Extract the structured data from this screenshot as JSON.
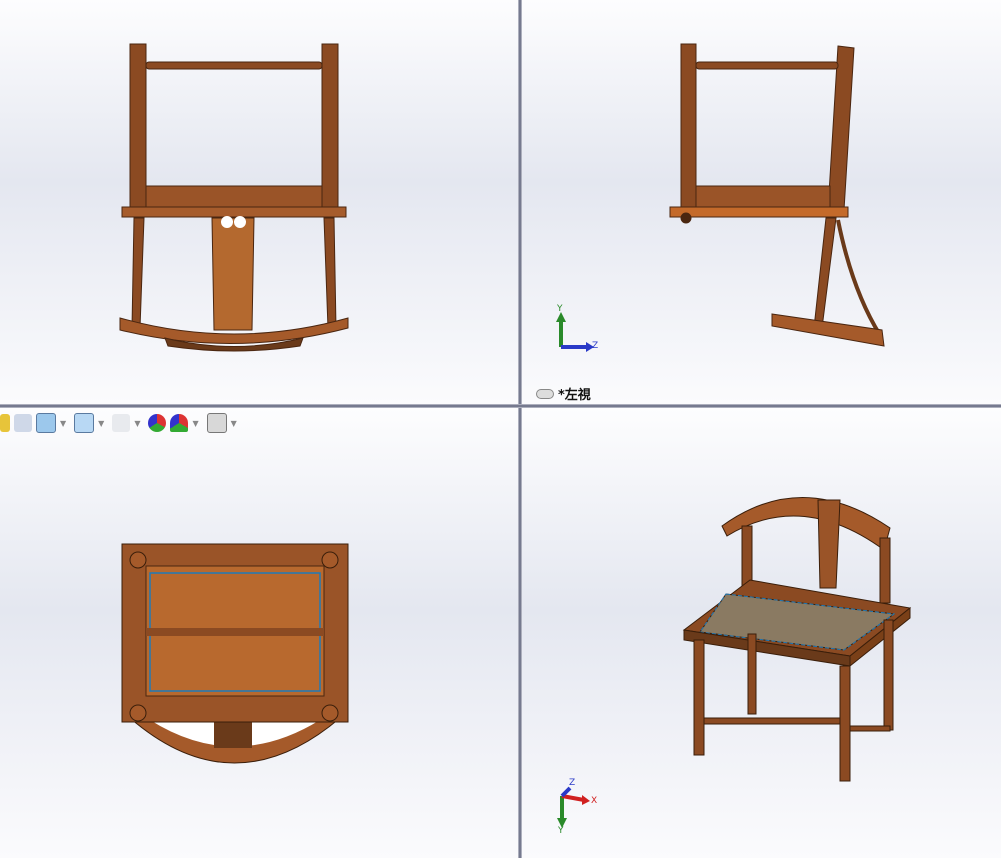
{
  "viewports": [
    {
      "name": "front-view"
    },
    {
      "name": "left-view",
      "label": "*左視"
    },
    {
      "name": "top-view"
    },
    {
      "name": "isometric-view"
    }
  ],
  "triad_left": {
    "x": "",
    "y": "Y",
    "z": "Z"
  },
  "triad_iso": {
    "x": "X",
    "y": "Y",
    "z": "Z"
  },
  "toolbar": {
    "icons": [
      "view-orientation-icon",
      "previous-view-icon",
      "section-view-icon",
      "display-style-icon",
      "hide-show-icon",
      "appearance-icon",
      "scene-icon",
      "display-settings-icon"
    ]
  },
  "colors": {
    "wood": "#8b4a22",
    "wood_light": "#b86a35",
    "seat": "#8a7a62",
    "edge": "#1f7ab8"
  }
}
